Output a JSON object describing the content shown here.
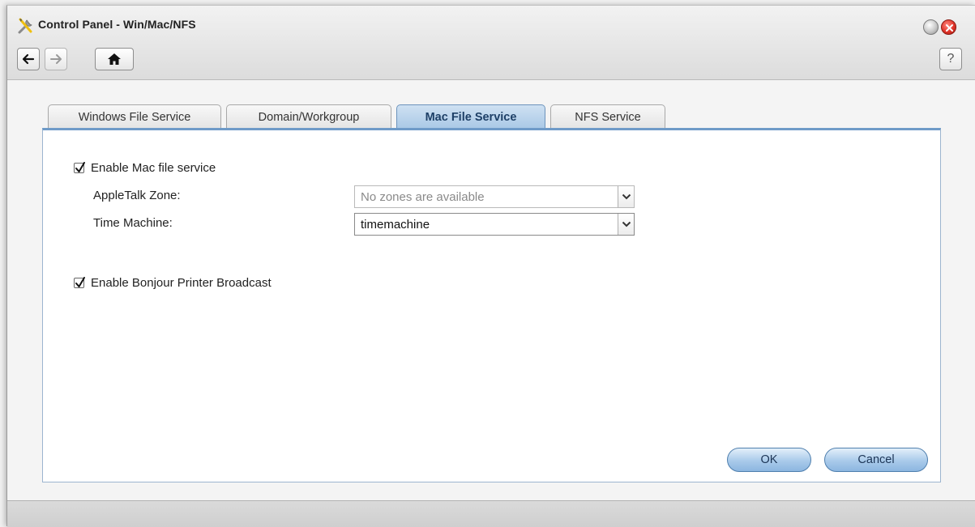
{
  "window": {
    "title": "Control Panel - Win/Mac/NFS",
    "app_icon": "tools-icon"
  },
  "toolbar": {
    "back_icon": "arrow-left-icon",
    "forward_icon": "arrow-right-icon",
    "home_icon": "home-icon",
    "help_label": "?"
  },
  "tabs": [
    {
      "label": "Windows File Service",
      "active": false
    },
    {
      "label": "Domain/Workgroup",
      "active": false
    },
    {
      "label": "Mac File Service",
      "active": true
    },
    {
      "label": "NFS Service",
      "active": false
    }
  ],
  "form": {
    "enable_mac": {
      "label": "Enable Mac file service",
      "checked": true
    },
    "appletalk": {
      "label": "AppleTalk Zone:",
      "value": "No zones are available",
      "disabled": true
    },
    "time_machine": {
      "label": "Time Machine:",
      "value": "timemachine",
      "disabled": false
    },
    "bonjour": {
      "label": "Enable Bonjour Printer Broadcast",
      "checked": true
    }
  },
  "buttons": {
    "ok": "OK",
    "cancel": "Cancel"
  },
  "colors": {
    "accent": "#6f9bc8",
    "close": "#e0342a"
  }
}
